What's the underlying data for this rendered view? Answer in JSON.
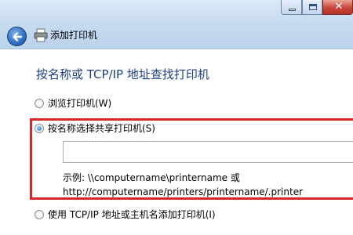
{
  "window": {
    "title": "添加打印机",
    "controls": [
      "minimize",
      "maximize",
      "close"
    ]
  },
  "heading": "按名称或 TCP/IP 地址查找打印机",
  "options": [
    {
      "label": "浏览打印机(W)",
      "checked": false
    },
    {
      "label": "按名称选择共享打印机(S)",
      "checked": true
    },
    {
      "label": "使用 TCP/IP 地址或主机名添加打印机(I)",
      "checked": false
    }
  ],
  "printer_name_input": {
    "value": "",
    "placeholder": ""
  },
  "example": {
    "line1": "示例: \\\\computername\\printername 或",
    "line2": "http://computername/printers/printername/.printer"
  },
  "colors": {
    "highlight": "#d9262b",
    "heading": "#1e3f86",
    "titlebar": "#c9dcf0"
  }
}
